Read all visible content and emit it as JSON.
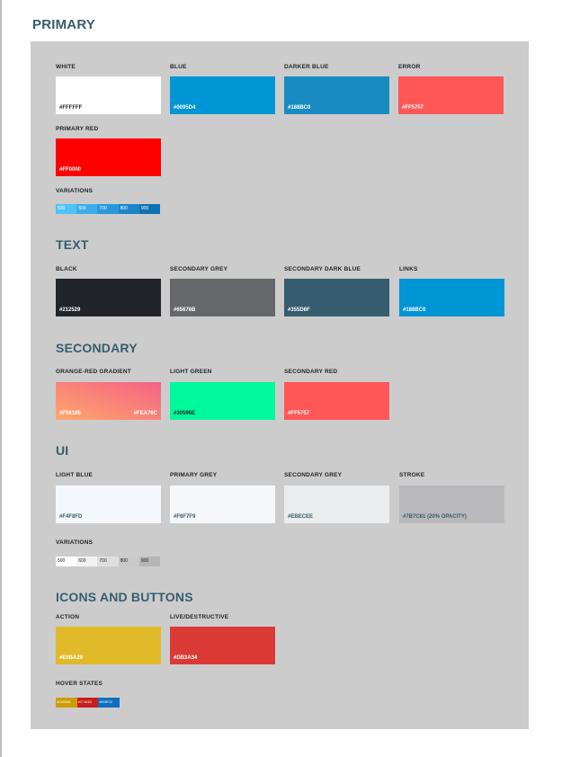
{
  "page": {
    "title": "PRIMARY"
  },
  "primary": {
    "swatches": [
      {
        "label": "WHITE",
        "hex": "#FFFFFF",
        "color": "#FFFFFF"
      },
      {
        "label": "BLUE",
        "hex": "#0095D4",
        "color": "#0095D4"
      },
      {
        "label": "DARKER BLUE",
        "hex": "#188BC0",
        "color": "#188BC0"
      },
      {
        "label": "ERROR",
        "hex": "#FF5757",
        "color": "#FF5757"
      },
      {
        "label": "PRIMARY RED",
        "hex": "#FF0000",
        "color": "#FF0000"
      }
    ],
    "variations_label": "VARIATIONS",
    "variations": [
      {
        "label": "500",
        "color": "#4FC3F7"
      },
      {
        "label": "600",
        "color": "#39AEEB"
      },
      {
        "label": "700",
        "color": "#2699DD"
      },
      {
        "label": "800",
        "color": "#1A86C9"
      },
      {
        "label": "900",
        "color": "#0E72B3"
      }
    ]
  },
  "text": {
    "title": "TEXT",
    "swatches": [
      {
        "label": "BLACK",
        "hex": "#212529",
        "color": "#212529"
      },
      {
        "label": "SECONDARY GREY",
        "hex": "#65676B",
        "color": "#65676B"
      },
      {
        "label": "SECONDARY DARK BLUE",
        "hex": "#355D6F",
        "color": "#355D6F"
      },
      {
        "label": "LINKS",
        "hex": "#188BC0",
        "color": "#0095D4"
      }
    ]
  },
  "secondary": {
    "title": "SECONDARY",
    "swatches": [
      {
        "label": "ORANGE-RED GRADIENT",
        "hex": "#F56185",
        "hex2": "#FEA76C",
        "color": "#F56185",
        "color2": "#FEA76C"
      },
      {
        "label": "LIGHT GREEN",
        "hex": "#30596E",
        "color": "#00F99A"
      },
      {
        "label": "SECONDARY RED",
        "hex": "#FF5757",
        "color": "#FF5757"
      }
    ]
  },
  "ui": {
    "title": "UI",
    "swatches": [
      {
        "label": "LIGHT BLUE",
        "hex": "#F4F8FD",
        "color": "#F4F8FD"
      },
      {
        "label": "PRIMARY GREY",
        "hex": "#F6F7F9",
        "color": "#F6F7F9"
      },
      {
        "label": "SECONDARY GREY",
        "hex": "#EBECEE",
        "color": "#EBECEE"
      },
      {
        "label": "STROKE",
        "hex": "#7B7C81 (20% OPACITY)",
        "color": "#B9B9BB"
      }
    ],
    "variations_label": "VARIATIONS",
    "variations": [
      {
        "label": "500",
        "color": "#FFFFFF"
      },
      {
        "label": "600",
        "color": "#F2F2F2"
      },
      {
        "label": "700",
        "color": "#DFDFDF"
      },
      {
        "label": "800",
        "color": "#C9C9C9"
      },
      {
        "label": "900",
        "color": "#B5B5B5"
      }
    ]
  },
  "icons_buttons": {
    "title": "ICONS AND BUTTONS",
    "swatches": [
      {
        "label": "ACTION",
        "hex": "#E0BA29",
        "color": "#E0BA29"
      },
      {
        "label": "LIVE/DESTRUCTIVE",
        "hex": "#DB3A34",
        "color": "#DB3A34"
      }
    ],
    "hover_label": "HOVER STATES",
    "hover": [
      {
        "label": "#CA9D06",
        "color": "#CA9D06"
      },
      {
        "label": "#C71D1D",
        "color": "#C71D1D"
      },
      {
        "label": "#0E6FC0",
        "color": "#0E6FC0"
      }
    ]
  }
}
